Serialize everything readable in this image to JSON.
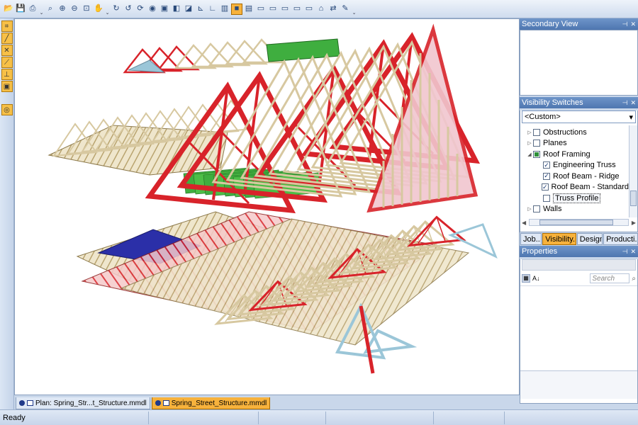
{
  "toolbar": {
    "icons": [
      "open-folder-icon",
      "save-icon",
      "print-icon",
      "more-icon",
      "zoom-icon",
      "zoom-in-icon",
      "zoom-out-icon",
      "zoom-window-icon",
      "pan-icon",
      "more-icon",
      "rotate-icon",
      "rotate-alt-icon",
      "orbit-icon",
      "camera-icon",
      "cube-icon",
      "view-icon",
      "isometric-icon",
      "axis-icon",
      "axis-alt-icon",
      "wireframe-icon",
      "shaded-icon",
      "book-icon",
      "note-icon",
      "note-icon",
      "note-icon",
      "note-icon",
      "note-icon",
      "house-icon",
      "walk-icon",
      "paint-icon",
      "more-icon"
    ]
  },
  "left_tools": [
    "snap-icon",
    "line-icon",
    "cross-icon",
    "measure-icon",
    "anchor-icon",
    "frame-icon",
    "tape-icon"
  ],
  "doc_tabs": [
    {
      "label": "Plan: Spring_Str...t_Structure.mmdl",
      "active": false
    },
    {
      "label": "Spring_Street_Structure.mmdl",
      "active": true
    }
  ],
  "status": {
    "text": "Ready"
  },
  "secondary_view": {
    "title": "Secondary View"
  },
  "visibility": {
    "title": "Visibility Switches",
    "preset": "<Custom>",
    "tree": [
      {
        "label": "Obstructions",
        "state": "unchecked",
        "expander": "▷",
        "indent": 0
      },
      {
        "label": "Planes",
        "state": "unchecked",
        "expander": "▷",
        "indent": 0
      },
      {
        "label": "Roof Framing",
        "state": "partial",
        "expander": "◢",
        "indent": 0
      },
      {
        "label": "Engineering Truss",
        "state": "checked",
        "expander": "",
        "indent": 1
      },
      {
        "label": "Roof Beam - Ridge",
        "state": "checked",
        "expander": "",
        "indent": 1
      },
      {
        "label": "Roof Beam - Standard",
        "state": "checked",
        "expander": "",
        "indent": 1
      },
      {
        "label": "Truss Profile",
        "state": "unchecked",
        "expander": "",
        "indent": 1,
        "selected": true
      },
      {
        "label": "Walls",
        "state": "unchecked",
        "expander": "▷",
        "indent": 0
      }
    ]
  },
  "panel_tabs": [
    {
      "label": "Job...",
      "active": false
    },
    {
      "label": "Visibility...",
      "active": true
    },
    {
      "label": "Design",
      "active": false
    },
    {
      "label": "Producti...",
      "active": false
    }
  ],
  "properties": {
    "title": "Properties",
    "search_placeholder": "Search"
  },
  "colors": {
    "truss_tan": "#d7c8a0",
    "truss_red": "#d8232a",
    "ridge_green": "#3fae3f",
    "truss_blue": "#9bc6d8",
    "accent_orange": "#f7b23c"
  }
}
